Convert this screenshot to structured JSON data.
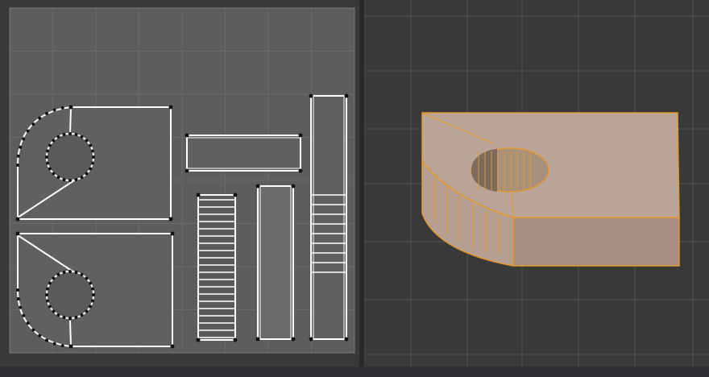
{
  "uv_editor": {
    "grid_fill": "#5d5d5d",
    "grid_line": "#6b6b6b",
    "edge_color": "#ffffff",
    "vertex_color": "#111111"
  },
  "viewport_3d": {
    "background": "#393939",
    "grid_line": "#4b4b4b",
    "mesh_top_color": "#b8a294",
    "mesh_side_color": "#a88c80",
    "selection_outline": "#e39a2c"
  },
  "splitter_color": "#2a2a2a",
  "status_bar_color": "#2f3033"
}
